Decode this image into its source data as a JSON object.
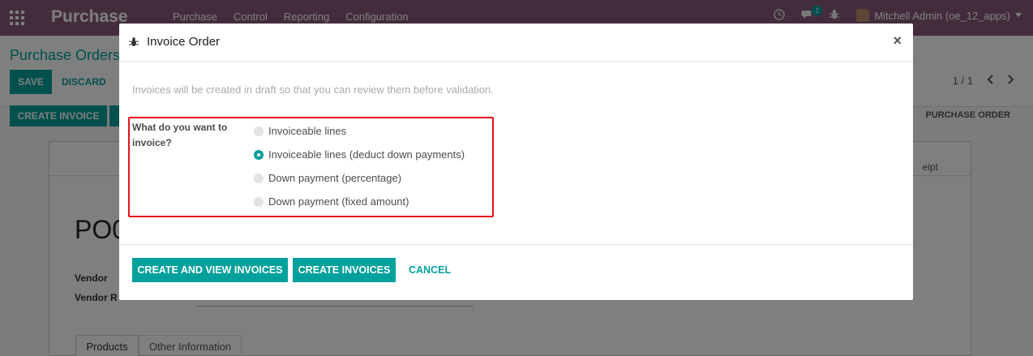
{
  "navbar": {
    "brand": "Purchase",
    "menu": [
      "Purchase",
      "Control",
      "Reporting",
      "Configuration"
    ],
    "message_badge": "1",
    "user": "Mitchell Admin (oe_12_apps)"
  },
  "control_panel": {
    "breadcrumb": "Purchase Orders",
    "save_label": "SAVE",
    "discard_label": "DISCARD",
    "pager": "1 / 1"
  },
  "statusbar": {
    "create_invoice_label": "CREATE INVOICE",
    "status_purchase_order": "PURCHASE ORDER"
  },
  "sheet": {
    "receipt_fragment": "eipt",
    "po_number_fragment": "PO0",
    "vendor_label": "Vendor",
    "vendor_ref_label": "Vendor R",
    "tabs": [
      "Products",
      "Other Information"
    ]
  },
  "modal": {
    "title": "Invoice Order",
    "description": "Invoices will be created in draft so that you can review them before validation.",
    "question": "What do you want to invoice?",
    "options": [
      {
        "label": "Invoiceable lines",
        "checked": false
      },
      {
        "label": "Invoiceable lines (deduct down payments)",
        "checked": true
      },
      {
        "label": "Down payment (percentage)",
        "checked": false
      },
      {
        "label": "Down payment (fixed amount)",
        "checked": false
      }
    ],
    "buttons": {
      "create_and_view": "CREATE AND VIEW INVOICES",
      "create": "CREATE INVOICES",
      "cancel": "CANCEL"
    },
    "close": "×"
  },
  "colors": {
    "navbar": "#875a7b",
    "accent": "#00a09d",
    "highlight": "#e8121b"
  }
}
